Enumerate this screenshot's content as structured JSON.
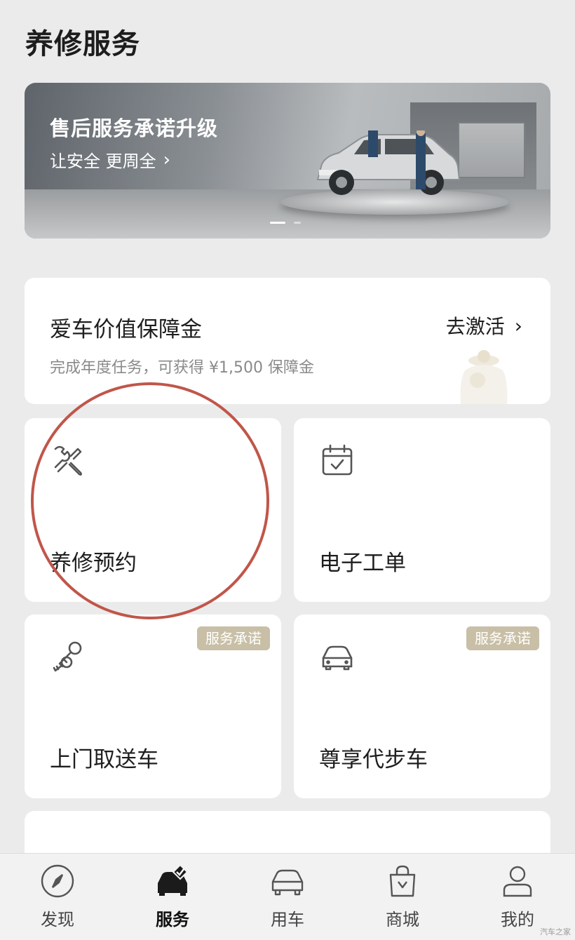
{
  "page": {
    "title": "养修服务"
  },
  "banner": {
    "title": "售后服务承诺升级",
    "subtitle": "让安全 更周全",
    "chevron": "›",
    "dots": 2,
    "active_dot": 0
  },
  "value_card": {
    "title": "爱车价值保障金",
    "subtitle": "完成年度任务，可获得 ¥1,500 保障金",
    "action_label": "去激活",
    "chevron": "›",
    "icon": "coin-jar-icon"
  },
  "tiles": [
    {
      "label": "养修预约",
      "icon": "wrench-screwdriver-icon",
      "badge": ""
    },
    {
      "label": "电子工单",
      "icon": "calendar-check-icon",
      "badge": ""
    },
    {
      "label": "上门取送车",
      "icon": "keys-icon",
      "badge": "服务承诺"
    },
    {
      "label": "尊享代步车",
      "icon": "car-front-icon",
      "badge": "服务承诺"
    }
  ],
  "bottom_nav": {
    "items": [
      {
        "label": "发现",
        "icon": "compass-icon"
      },
      {
        "label": "服务",
        "icon": "car-service-icon"
      },
      {
        "label": "用车",
        "icon": "car-icon"
      },
      {
        "label": "商城",
        "icon": "shopping-bag-icon"
      },
      {
        "label": "我的",
        "icon": "user-icon"
      }
    ],
    "active_index": 1
  },
  "colors": {
    "background": "#ebebeb",
    "badge": "#c8bfa6",
    "annotation": "#c0564a"
  },
  "watermark": "汽车之家"
}
